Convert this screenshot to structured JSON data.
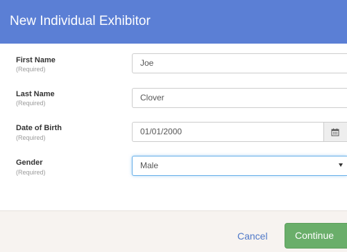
{
  "dialog": {
    "title": "New Individual Exhibitor"
  },
  "fields": {
    "first_name": {
      "label": "First Name",
      "hint": "(Required)",
      "value": "Joe"
    },
    "last_name": {
      "label": "Last Name",
      "hint": "(Required)",
      "value": "Clover"
    },
    "date_of_birth": {
      "label": "Date of Birth",
      "hint": "(Required)",
      "value": "01/01/2000",
      "icon": "calendar-icon"
    },
    "gender": {
      "label": "Gender",
      "hint": "(Required)",
      "value": "Male",
      "icon": "caret-down-icon"
    }
  },
  "footer": {
    "cancel_label": "Cancel",
    "continue_label": "Continue"
  },
  "colors": {
    "header": "#5b7fd5",
    "continue": "#6aae6a",
    "link": "#4f78c8",
    "footer": "#f7f3f0"
  }
}
